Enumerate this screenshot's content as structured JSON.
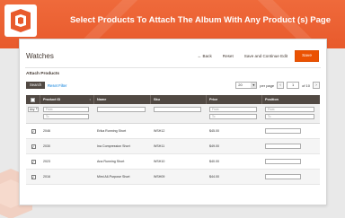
{
  "banner": {
    "title": "Select Products To Attach The Album With Any Product (s) Page",
    "brand_color": "#e85a2c"
  },
  "page": {
    "title": "Watches",
    "back_label": "Back",
    "reset_label": "Reset",
    "save_continue_label": "Save and Continue Edit",
    "save_label": "Save",
    "accent_color": "#eb5202"
  },
  "grid": {
    "section_title": "Attach Products",
    "search_label": "Search",
    "reset_filter_label": "Reset Filter",
    "per_page_value": "20",
    "per_page_label": "per page",
    "current_page": "1",
    "total_pages_label": "of 10",
    "prev_icon": "chevron-left-icon",
    "next_icon": "chevron-right-icon",
    "columns": [
      "Product ID",
      "Name",
      "Sku",
      "Price",
      "Position"
    ],
    "sort_indicator": "↕",
    "filters": {
      "any_label": "Any",
      "from_placeholder": "From",
      "to_placeholder": "To"
    },
    "rows": [
      {
        "checked": "✓",
        "id": "2046",
        "name": "Erika Running Short",
        "sku": "WSH12",
        "price": "$45.00"
      },
      {
        "checked": "✓",
        "id": "2030",
        "name": "Ina Compression Short",
        "sku": "WSH11",
        "price": "$49.00"
      },
      {
        "checked": "✓",
        "id": "2023",
        "name": "Ana Running Short",
        "sku": "WSH10",
        "price": "$40.00"
      },
      {
        "checked": "✓",
        "id": "2016",
        "name": "Mimi All-Purpose Short",
        "sku": "WSH09",
        "price": "$44.00"
      }
    ]
  }
}
